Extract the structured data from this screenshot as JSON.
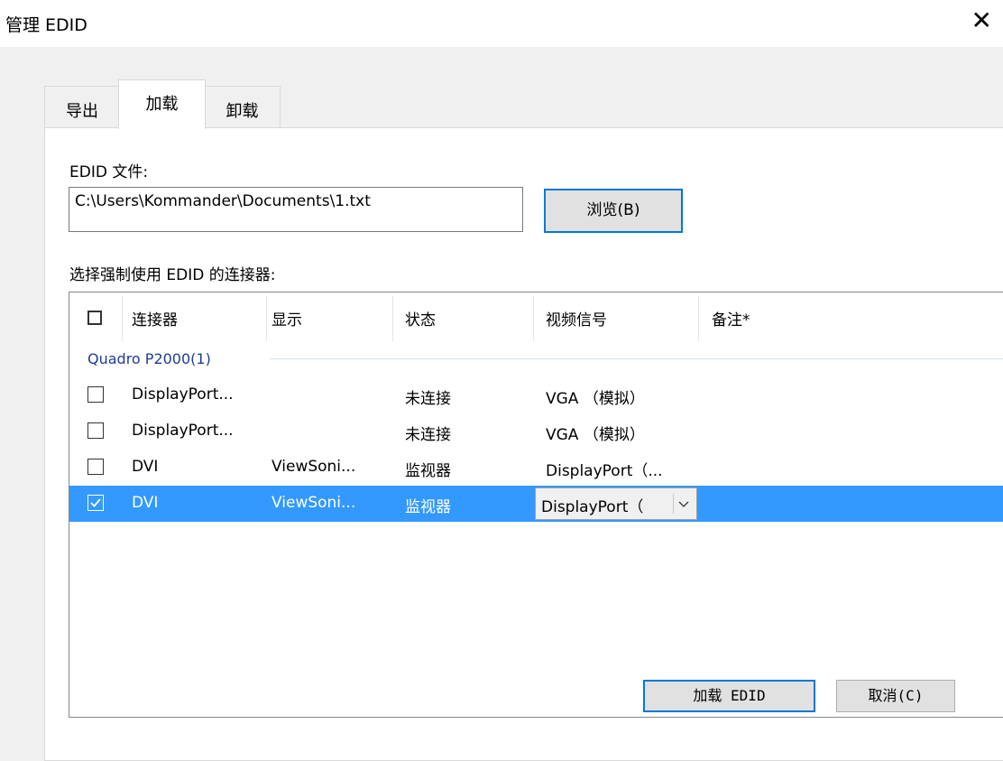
{
  "window": {
    "title": "管理 EDID",
    "close_glyph": "✕"
  },
  "tabs": [
    {
      "label": "导出"
    },
    {
      "label": "加载",
      "selected": true
    },
    {
      "label": "卸载"
    }
  ],
  "edid_file": {
    "label": "EDID 文件:",
    "value": "C:\\Users\\Kommander\\Documents\\1.txt",
    "browse_label": "浏览(B)"
  },
  "connectors": {
    "label": "选择强制使用 EDID 的连接器:",
    "columns": [
      "连接器",
      "显示",
      "状态",
      "视频信号",
      "备注*"
    ],
    "group": "Quadro P2000(1)",
    "rows": [
      {
        "checked": false,
        "connector": "DisplayPort...",
        "display": "",
        "status": "未连接",
        "signal": "VGA （模拟）"
      },
      {
        "checked": false,
        "connector": "DisplayPort...",
        "display": "",
        "status": "未连接",
        "signal": "VGA （模拟）"
      },
      {
        "checked": false,
        "connector": "DVI",
        "display": "ViewSoni...",
        "status": "监视器",
        "signal": "DisplayPort（..."
      },
      {
        "checked": true,
        "connector": "DVI",
        "display": "ViewSoni...",
        "status": "监视器",
        "signal": "DisplayPort（",
        "selected": true
      }
    ]
  },
  "footer": {
    "load_label": "加载 EDID",
    "cancel_label": "取消(C)"
  },
  "colors": {
    "selection": "#3399ff",
    "group_text": "#1e3d96",
    "focus_border": "#0078d7"
  }
}
